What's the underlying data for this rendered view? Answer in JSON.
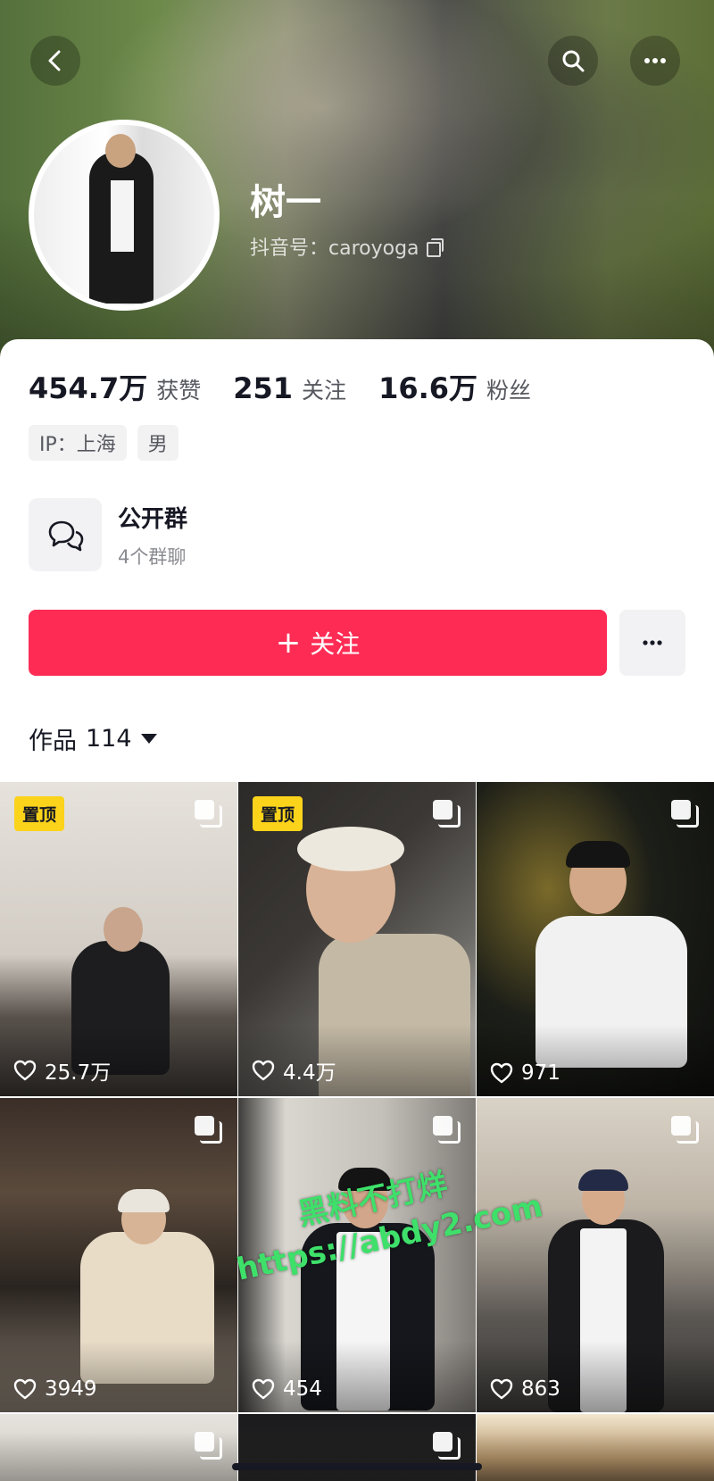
{
  "profile": {
    "name": "树一",
    "douyin_id": "抖音号：caroyoga"
  },
  "stats": {
    "likes_value": "454.7万",
    "likes_label": "获赞",
    "following_value": "251",
    "following_label": "关注",
    "followers_value": "16.6万",
    "followers_label": "粉丝"
  },
  "tags": {
    "ip": "IP：上海",
    "gender": "男"
  },
  "group": {
    "title": "公开群",
    "subtitle": "4个群聊"
  },
  "actions": {
    "follow_label": "关注",
    "follow_plus": "+"
  },
  "works": {
    "label": "作品",
    "count": "114"
  },
  "videos": [
    {
      "likes": "25.7万",
      "pinned": "置顶"
    },
    {
      "likes": "4.4万",
      "pinned": "置顶"
    },
    {
      "likes": "971"
    },
    {
      "likes": "3949"
    },
    {
      "likes": "454"
    },
    {
      "likes": "863"
    }
  ],
  "watermark": {
    "line1": "黑料不打烊",
    "line2": "https://abdy2.com"
  },
  "icons": {
    "back": "back-icon",
    "search": "search-icon",
    "more": "more-icon",
    "chat": "group-chat-icon",
    "heart": "heart-icon",
    "multi": "multi-image-icon"
  },
  "colors": {
    "accent": "#fe2c55",
    "pin": "#fbd31b",
    "watermark": "#3ee06a"
  }
}
